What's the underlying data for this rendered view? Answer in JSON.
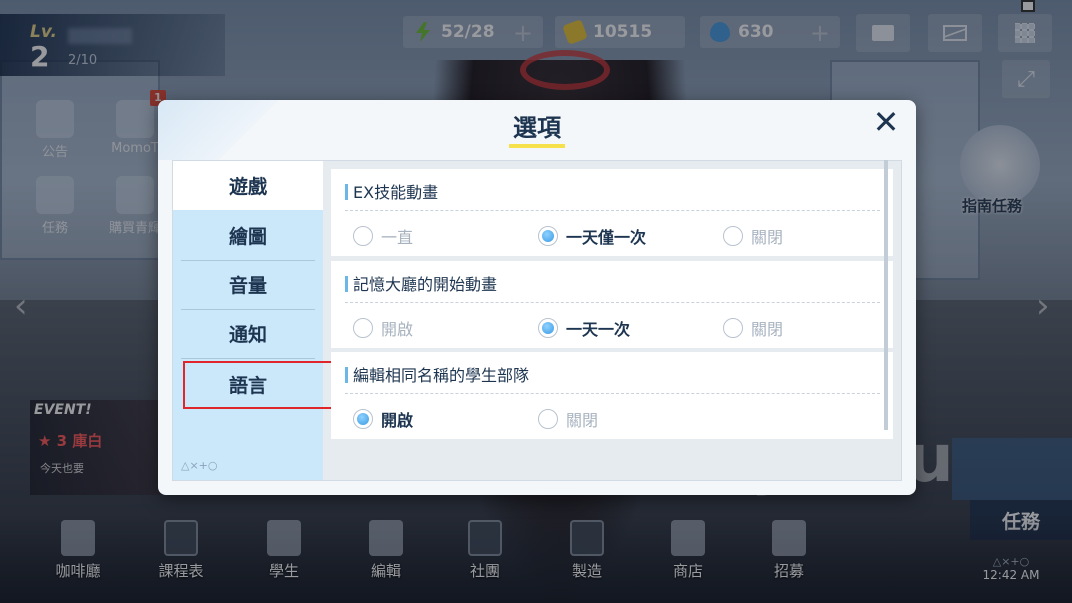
{
  "hud": {
    "level_label": "Lv.",
    "level_value": "2",
    "exp_text": "2/10",
    "resources": [
      {
        "name": "ap",
        "value": "52/28",
        "has_plus": true,
        "icon": "lightning-icon",
        "color": "#6ec03a"
      },
      {
        "name": "credits",
        "value": "10515",
        "has_plus": false,
        "icon": "coin-icon",
        "color": "#e8c43a"
      },
      {
        "name": "pyroxene",
        "value": "630",
        "has_plus": true,
        "icon": "gem-icon",
        "color": "#4b9de0"
      }
    ],
    "plus_symbol": "+",
    "expand_symbol": "⤢"
  },
  "side_menu": {
    "left": [
      {
        "label": "公告"
      },
      {
        "label": "MomoT"
      },
      {
        "label": "任務"
      },
      {
        "label": "購買青輝"
      }
    ],
    "badge_count": "1",
    "event": {
      "title": "EVENT!",
      "subtitle": "★ 3 庫白",
      "note": "今天也要"
    },
    "guide_label": "指南任務",
    "task_label": "任務",
    "arrow_left": "‹",
    "arrow_right": "›"
  },
  "watermark": "bjubiu",
  "dock": {
    "items": [
      {
        "label": "咖啡廳",
        "locked": false
      },
      {
        "label": "課程表",
        "locked": true
      },
      {
        "label": "學生",
        "locked": false
      },
      {
        "label": "編輯",
        "locked": false
      },
      {
        "label": "社團",
        "locked": true
      },
      {
        "label": "製造",
        "locked": true
      },
      {
        "label": "商店",
        "locked": false
      },
      {
        "label": "招募",
        "locked": false
      }
    ],
    "clock_shapes": "△×+○",
    "clock_time": "12:42 AM"
  },
  "dialog": {
    "title": "選項",
    "close_symbol": "✕",
    "tabs": [
      {
        "label": "遊戲",
        "active": true
      },
      {
        "label": "繪圖",
        "active": false
      },
      {
        "label": "音量",
        "active": false
      },
      {
        "label": "通知",
        "active": false
      },
      {
        "label": "語言",
        "active": false
      }
    ],
    "tab_shapes": "△×+○",
    "options": [
      {
        "heading": "EX技能動畫",
        "choices": [
          {
            "label": "一直",
            "selected": false
          },
          {
            "label": "一天僅一次",
            "selected": true
          },
          {
            "label": "關閉",
            "selected": false
          }
        ]
      },
      {
        "heading": "記憶大廳的開始動畫",
        "choices": [
          {
            "label": "開啟",
            "selected": false
          },
          {
            "label": "一天一次",
            "selected": true
          },
          {
            "label": "關閉",
            "selected": false
          }
        ]
      },
      {
        "heading": "編輯相同名稱的學生部隊",
        "choices": [
          {
            "label": "開啟",
            "selected": true
          },
          {
            "label": "關閉",
            "selected": false
          }
        ]
      }
    ]
  },
  "colors": {
    "accent_yellow": "#f6e04b",
    "navy_text": "#1d3550",
    "tab_blue": "#cbe7fa",
    "highlight_red": "#e0262b",
    "radio_blue": "#3a9ae3"
  }
}
